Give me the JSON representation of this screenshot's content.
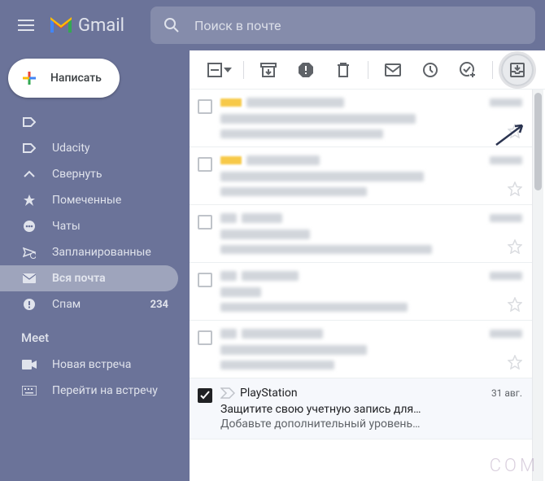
{
  "header": {
    "app_name": "Gmail",
    "search_placeholder": "Поиск в почте"
  },
  "compose_label": "Написать",
  "sidebar": {
    "items": [
      {
        "label": "",
        "icon": "label",
        "count": ""
      },
      {
        "label": "Udacity",
        "icon": "label",
        "count": ""
      },
      {
        "label": "Свернуть",
        "icon": "collapse",
        "count": ""
      },
      {
        "label": "Помеченные",
        "icon": "star",
        "count": ""
      },
      {
        "label": "Чаты",
        "icon": "chat",
        "count": ""
      },
      {
        "label": "Запланированные",
        "icon": "scheduled",
        "count": ""
      },
      {
        "label": "Вся почта",
        "icon": "all-mail",
        "count": "",
        "active": true
      },
      {
        "label": "Спам",
        "icon": "spam",
        "count": "234"
      }
    ]
  },
  "meet": {
    "header": "Meet",
    "items": [
      {
        "label": "Новая встреча",
        "icon": "video"
      },
      {
        "label": "Перейти на встречу",
        "icon": "keyboard"
      }
    ]
  },
  "selected_mail": {
    "sender": "PlayStation",
    "date": "31 авг.",
    "subject": "Защитите свою учетную запись для…",
    "snippet": "Добавьте дополнительный уровень…"
  },
  "watermark": "COM"
}
